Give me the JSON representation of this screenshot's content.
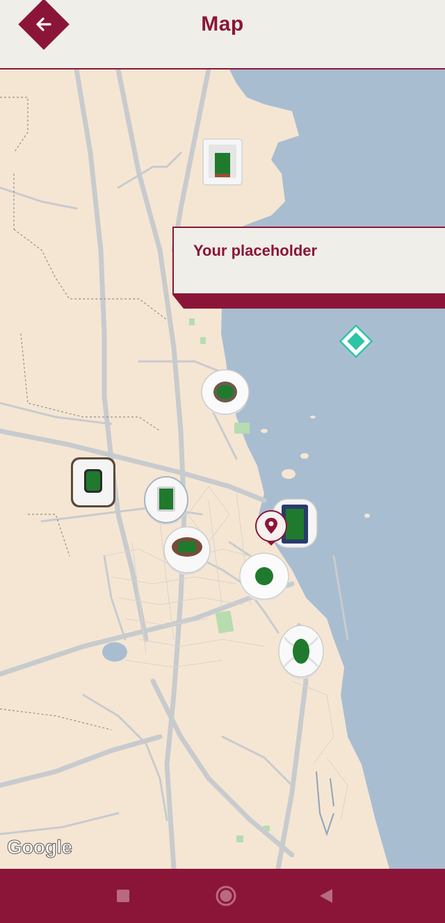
{
  "header": {
    "title": "Map",
    "back_icon": "arrow-left-icon"
  },
  "info_card": {
    "text": "Your placeholder"
  },
  "map": {
    "attribution": "Google",
    "stadium_markers": [
      "stadium-marker-al-bayt",
      "stadium-marker-lusail",
      "stadium-marker-education-city",
      "stadium-marker-ahmad-bin-ali",
      "stadium-marker-khalifa",
      "stadium-marker-974",
      "stadium-marker-thumama",
      "stadium-marker-al-janoub"
    ],
    "location_pin_icon": "location-pin-icon",
    "poi_icon": "diamond-poi-icon"
  },
  "navbar": {
    "recents_icon": "square-icon",
    "home_icon": "circle-home-icon",
    "back_icon": "triangle-back-icon"
  },
  "colors": {
    "brand": "#8b1538",
    "header_bg": "#f0eee8",
    "land": "#f5e6d3",
    "water": "#a9bdd1",
    "road": "#c8cbce",
    "park": "#b7dcb0",
    "poi": "#2ec4a6"
  }
}
